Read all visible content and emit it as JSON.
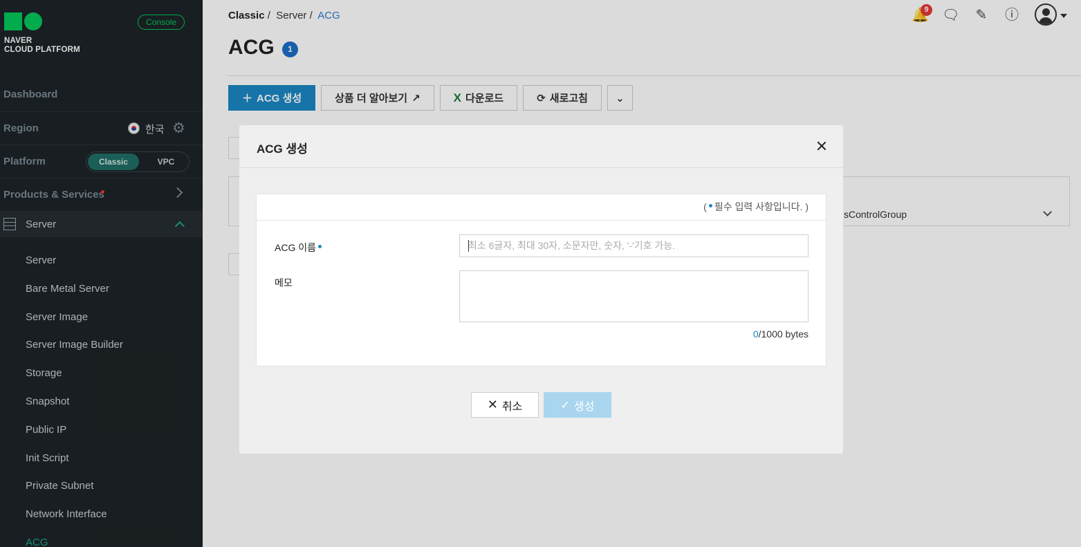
{
  "sidebar": {
    "logo_text_line1": "NAVER",
    "logo_text_line2": "CLOUD PLATFORM",
    "console_badge": "Console",
    "dashboard_label": "Dashboard",
    "region_label": "Region",
    "region_value": "한국",
    "platform_label": "Platform",
    "platform_options": [
      "Classic",
      "VPC"
    ],
    "platform_selected": "Classic",
    "products_label": "Products & Services",
    "section_label": "Server",
    "items": [
      {
        "label": "Server"
      },
      {
        "label": "Bare Metal Server"
      },
      {
        "label": "Server Image"
      },
      {
        "label": "Server Image Builder"
      },
      {
        "label": "Storage"
      },
      {
        "label": "Snapshot"
      },
      {
        "label": "Public IP"
      },
      {
        "label": "Init Script"
      },
      {
        "label": "Private Subnet"
      },
      {
        "label": "Network Interface"
      },
      {
        "label": "ACG"
      }
    ],
    "active_item": "ACG",
    "accent_color": "#1aa58d",
    "brand_color": "#03c75a"
  },
  "header": {
    "breadcrumb": [
      "Classic",
      "Server",
      "ACG"
    ],
    "breadcrumb_sep": "/",
    "title": "ACG",
    "title_badge": "1",
    "notification_count": "9",
    "icons": [
      "bell-icon",
      "chat-icon",
      "note-icon",
      "info-icon",
      "user-avatar-icon"
    ]
  },
  "toolbar": {
    "create_label": "ACG 생성",
    "learn_more_label": "상품 더 알아보기",
    "download_label": "다운로드",
    "refresh_label": "새로고침"
  },
  "background_table": {
    "visible_text": "sControlGroup"
  },
  "modal": {
    "title": "ACG 생성",
    "required_note_open": "(",
    "required_note_text": "필수 입력 사항입니다.",
    "required_note_close": ")",
    "name_label": "ACG 이름",
    "name_placeholder": "최소 6글자, 최대 30자, 소문자만, 숫자, '-'기호 가능.",
    "name_value": "",
    "memo_label": "메모",
    "memo_value": "",
    "byte_used": "0",
    "byte_limit": "/1000 bytes",
    "cancel_label": "취소",
    "create_label": "생성",
    "create_enabled": false
  }
}
